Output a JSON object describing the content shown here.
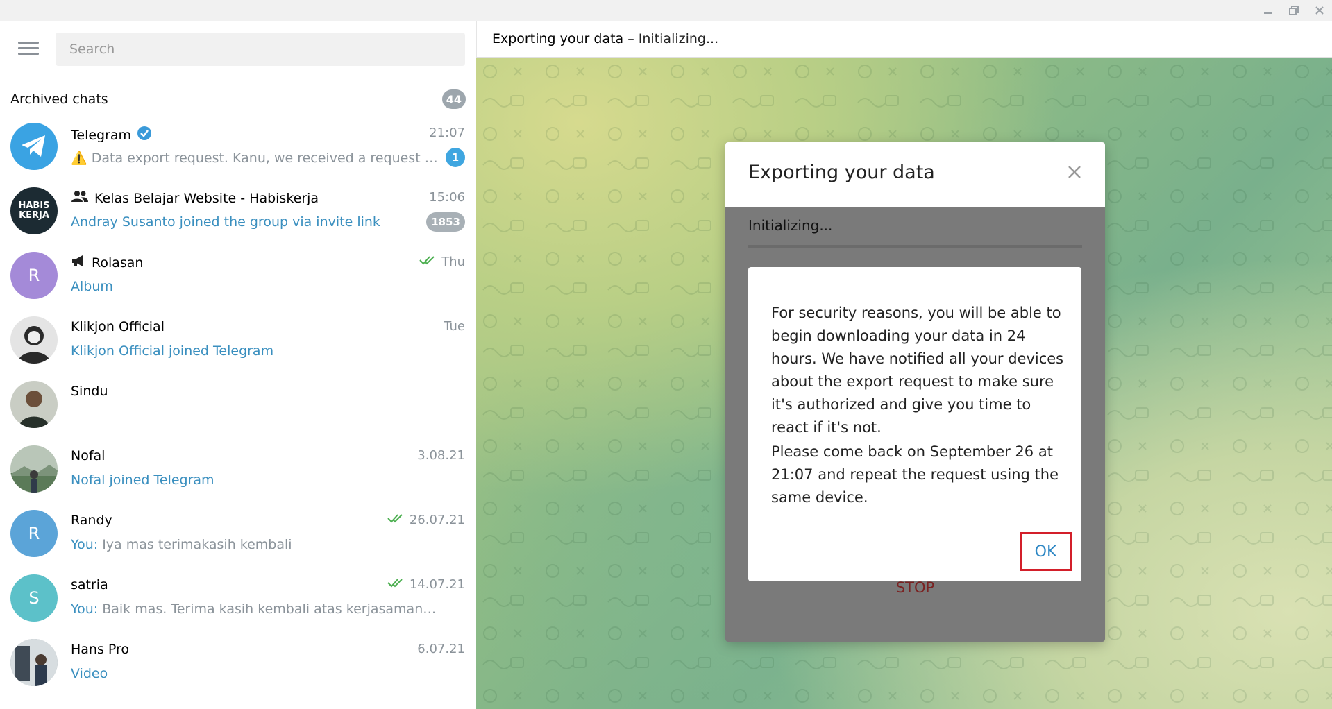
{
  "search": {
    "placeholder": "Search"
  },
  "archived": {
    "label": "Archived chats",
    "count": "44"
  },
  "chats": [
    {
      "name": "Telegram",
      "time": "21:07",
      "warn": "⚠️",
      "message": "Data export request. Kanu, we received a request fro...",
      "unread": "1",
      "avatar_color": "#3aa3e3"
    },
    {
      "name": "Kelas Belajar Website - Habiskerja",
      "time": "15:06",
      "message": "Andray Susanto joined the group via invite link",
      "unread": "1853",
      "avatar_text": "HABIS KERJA",
      "avatar_color": "#1c2b33"
    },
    {
      "name": "Rolasan",
      "time": "Thu",
      "message": "Album",
      "avatar_text": "R",
      "avatar_color": "#a48ad8"
    },
    {
      "name": "Klikjon Official",
      "time": "Tue",
      "message": "Klikjon Official joined Telegram",
      "avatar_color": "#dcdcdc"
    },
    {
      "name": "Sindu",
      "time": "",
      "message": "",
      "avatar_color": "#6f7a68"
    },
    {
      "name": "Nofal",
      "time": "3.08.21",
      "message": "Nofal joined Telegram",
      "avatar_color": "#7a8f7a"
    },
    {
      "name": "Randy",
      "time": "26.07.21",
      "sender": "You:",
      "message": "Iya mas terimakasih kembali",
      "avatar_text": "R",
      "avatar_color": "#5ba4d8"
    },
    {
      "name": "satria",
      "time": "14.07.21",
      "sender": "You:",
      "message": "Baik mas. Terima kasih kembali atas kerjasamanya",
      "avatar_text": "S",
      "avatar_color": "#5cc1c9"
    },
    {
      "name": "Hans Pro",
      "time": "6.07.21",
      "message": "Video",
      "avatar_color": "#4a5560"
    }
  ],
  "header": {
    "title": "Exporting your data",
    "separator": " – ",
    "status": "Initializing..."
  },
  "modal": {
    "title": "Exporting your data",
    "progress_label": "Initializing...",
    "progress": 0,
    "stop_label": "STOP",
    "message_p1": "For security reasons, you will be able to begin downloading your data in 24 hours. We have notified all your devices about the export request to make sure it's authorized and give you time to react if it's not.",
    "message_p2": "Please come back on September 26 at 21:07 and repeat the request using the same device.",
    "ok_label": "OK"
  }
}
